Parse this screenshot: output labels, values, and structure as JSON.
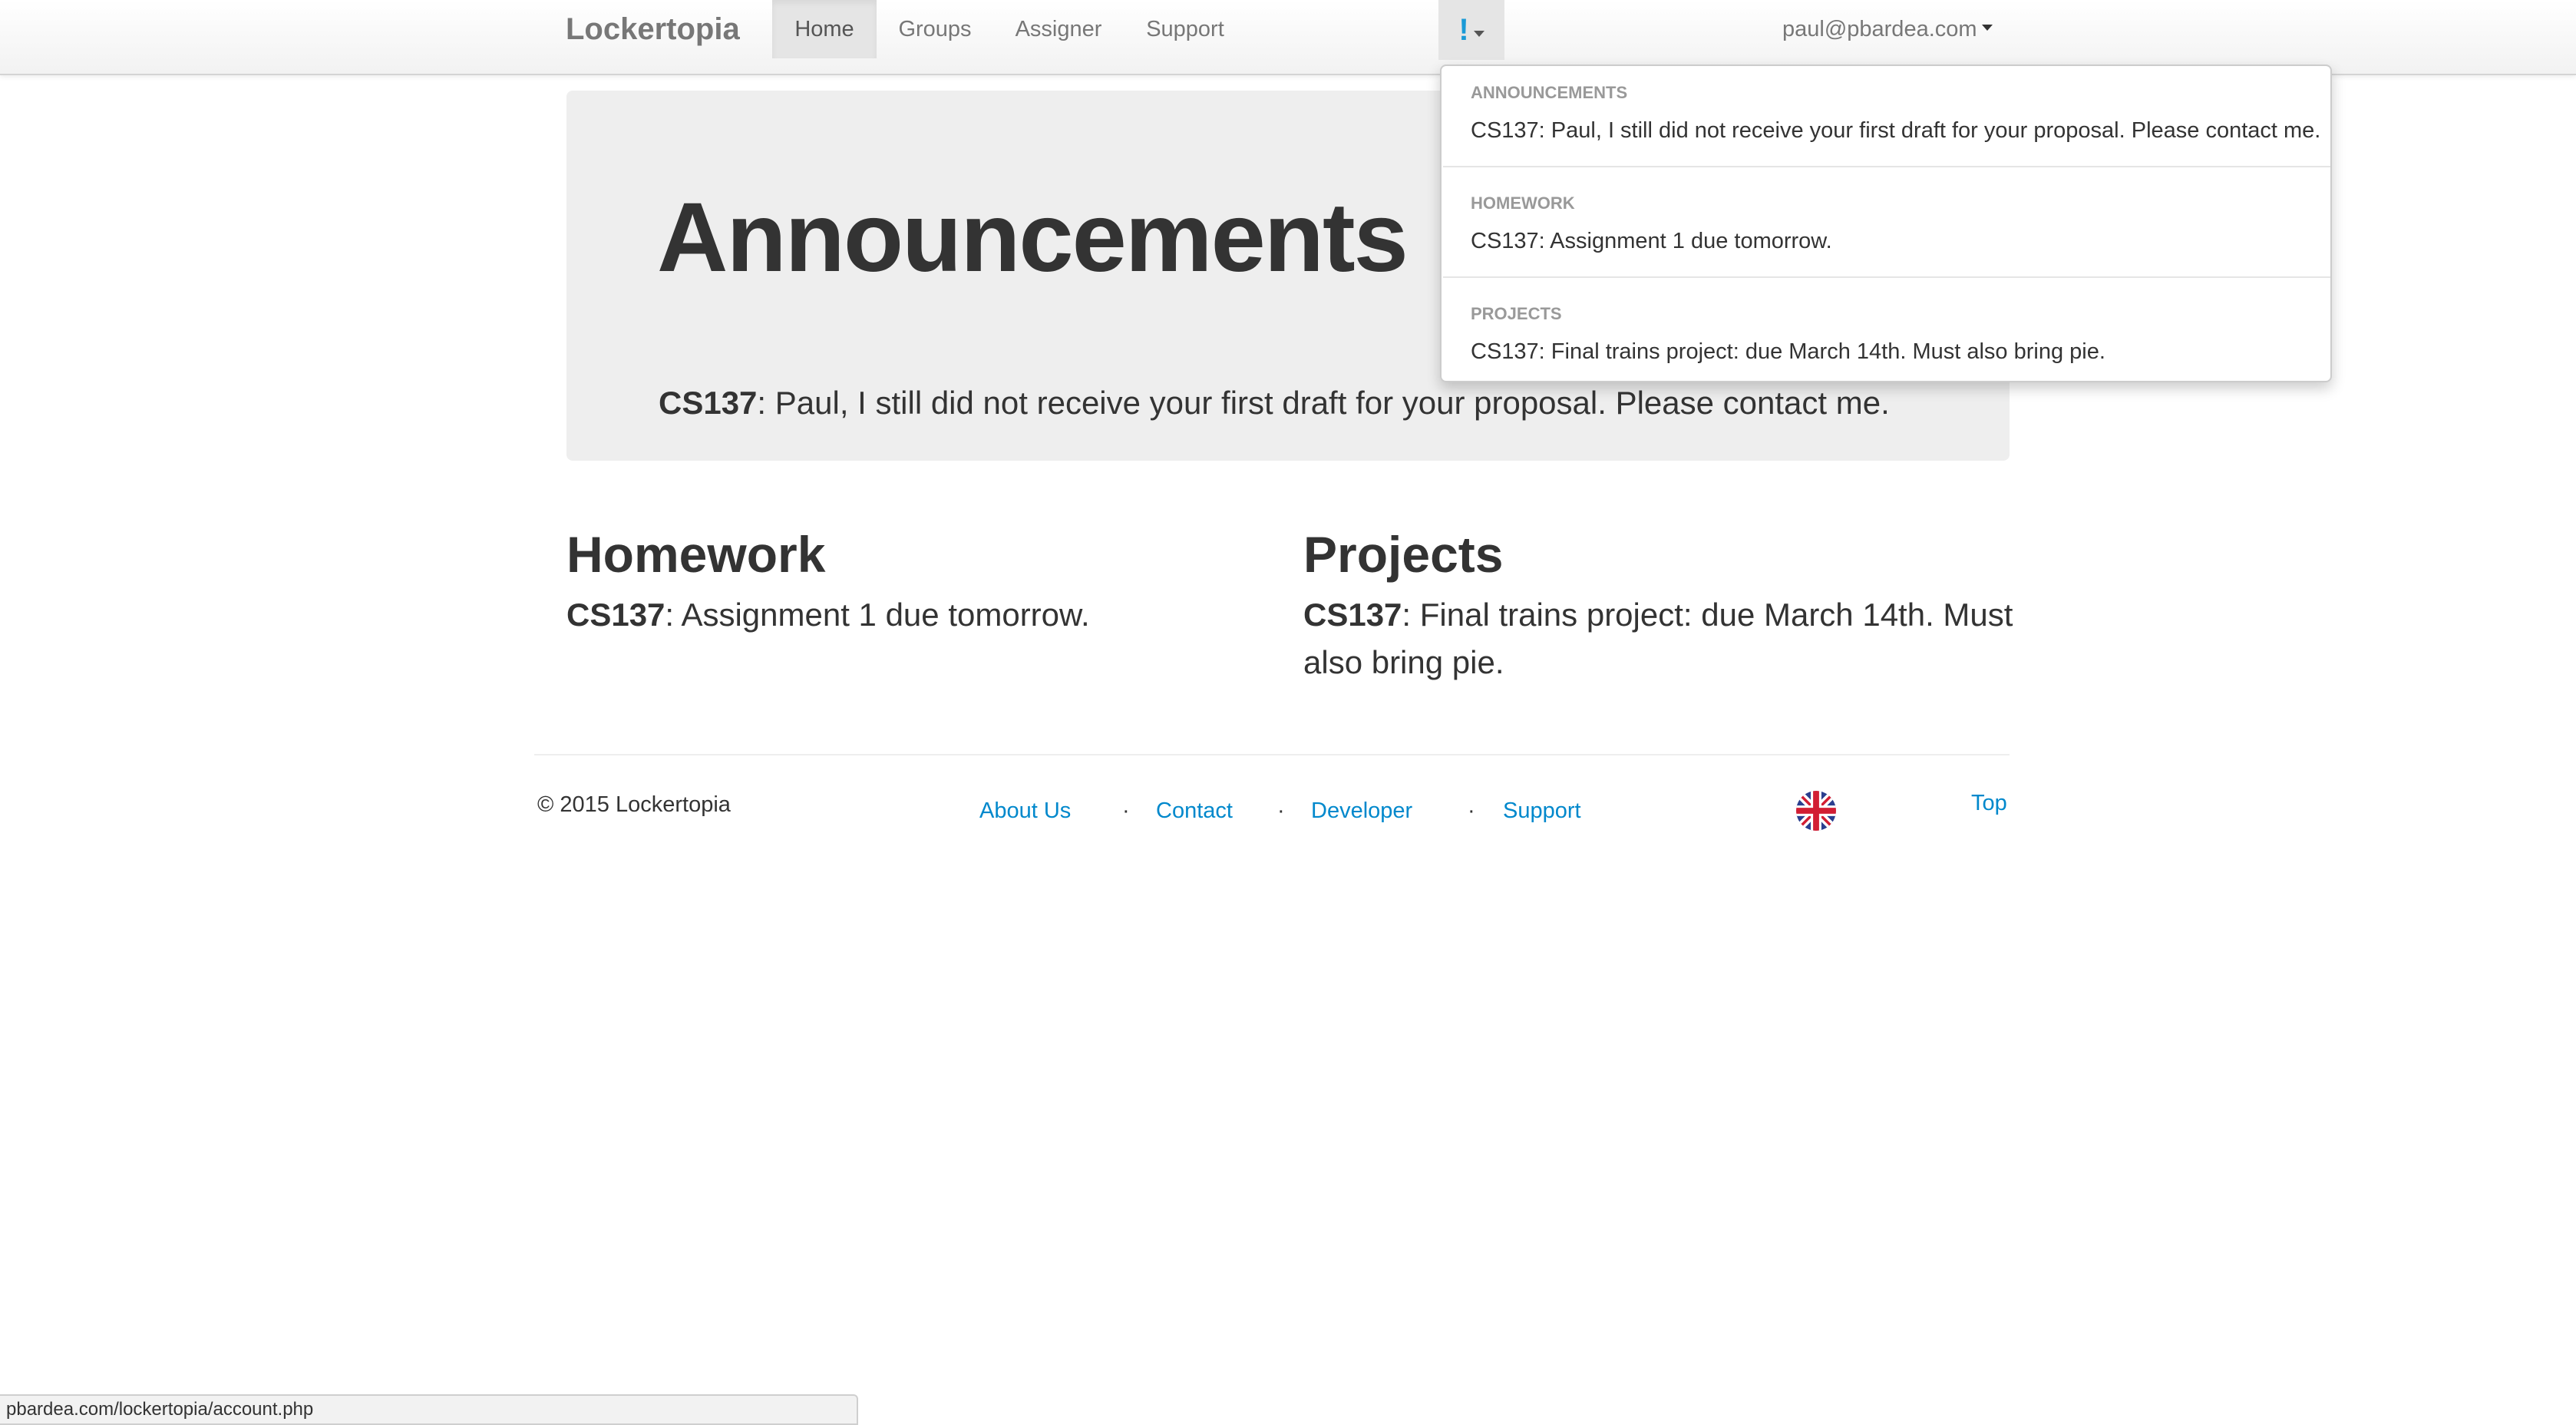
{
  "navbar": {
    "brand": "Lockertopia",
    "items": [
      {
        "label": "Home",
        "active": true
      },
      {
        "label": "Groups",
        "active": false
      },
      {
        "label": "Assigner",
        "active": false
      },
      {
        "label": "Support",
        "active": false
      }
    ],
    "alert_icon": "!",
    "user_email": "paul@pbardea.com"
  },
  "hero": {
    "title": "Announcements",
    "course": "CS137",
    "text": ": Paul, I still did not receive your first draft for your proposal. Please contact me."
  },
  "homework": {
    "title": "Homework",
    "course": "CS137",
    "text": ": Assignment 1 due tomorrow."
  },
  "projects": {
    "title": "Projects",
    "course": "CS137",
    "text": ": Final trains project: due March 14th. Must also bring pie."
  },
  "footer": {
    "copyright": "© 2015 Lockertopia",
    "links": [
      "About Us",
      "Contact",
      "Developer",
      "Support"
    ],
    "separator": "·",
    "flag_icon": "uk-flag-icon",
    "top_label": "Top"
  },
  "dropdown": {
    "sections": [
      {
        "header": "ANNOUNCEMENTS",
        "item": "CS137: Paul, I still did not receive your first draft for your proposal. Please contact me."
      },
      {
        "header": "HOMEWORK",
        "item": "CS137: Assignment 1 due tomorrow."
      },
      {
        "header": "PROJECTS",
        "item": "CS137: Final trains project: due March 14th. Must also bring pie."
      }
    ]
  },
  "status_bar": {
    "url": "pbardea.com/lockertopia/account.php"
  },
  "colors": {
    "link": "#0088cc",
    "alert_icon": "#1a9ad6",
    "hero_bg": "#eeeeee"
  }
}
